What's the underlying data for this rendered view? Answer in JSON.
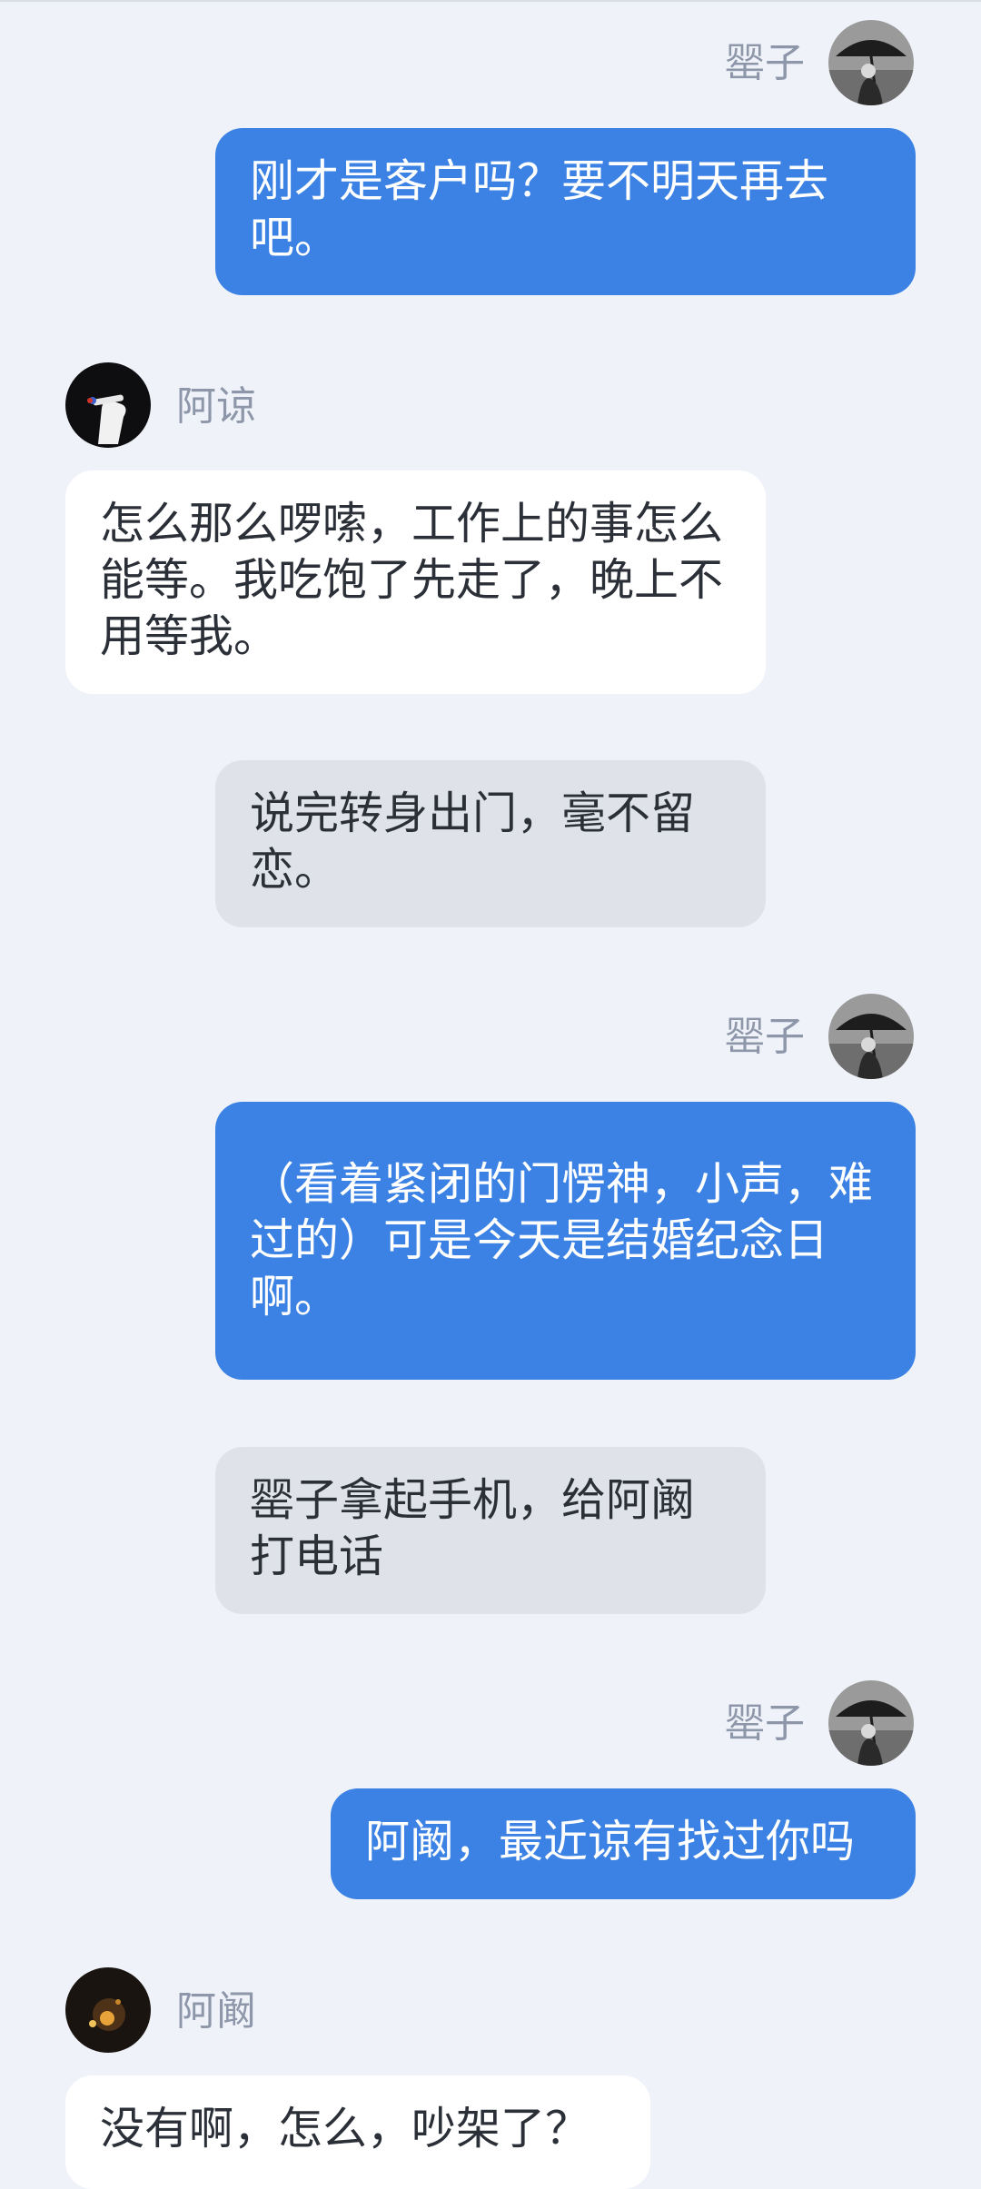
{
  "messages": [
    {
      "sender": "罂子",
      "avatar_icon": "umbrella-portrait-icon",
      "text": "刚才是客户吗？要不明天再去吧。"
    },
    {
      "sender": "阿谅",
      "avatar_icon": "hand-cigarette-avatar-icon",
      "text": "怎么那么啰嗦，工作上的事怎么能等。我吃饱了先走了，晚上不用等我。"
    },
    {
      "narration": "说完转身出门，毫不留恋。"
    },
    {
      "sender": "罂子",
      "avatar_icon": "umbrella-portrait-icon",
      "text": "（看着紧闭的门愣神，小声，难过的）可是今天是结婚纪念日啊。"
    },
    {
      "narration": "罂子拿起手机，给阿阚打电话"
    },
    {
      "sender": "罂子",
      "avatar_icon": "umbrella-portrait-icon",
      "text": "阿阚，最近谅有找过你吗"
    },
    {
      "sender": "阿阚",
      "avatar_icon": "firelight-avatar-icon",
      "text": "没有啊，怎么，吵架了？"
    }
  ],
  "colors": {
    "background": "#eff2f8",
    "outgoing_bubble": "#3b82e4",
    "incoming_bubble": "#ffffff",
    "narration_bubble": "#dfe2e9",
    "name_text": "#8d97a9"
  }
}
